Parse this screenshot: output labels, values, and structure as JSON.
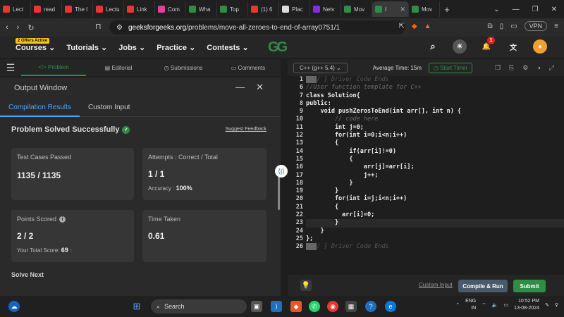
{
  "browser": {
    "tabs": [
      {
        "label": "Lect",
        "color": "#e33"
      },
      {
        "label": "read",
        "color": "#e33"
      },
      {
        "label": "The I",
        "color": "#e33"
      },
      {
        "label": "Lectu",
        "color": "#e33"
      },
      {
        "label": "Link",
        "color": "#e33"
      },
      {
        "label": "Com",
        "color": "#e040a0"
      },
      {
        "label": "Wha",
        "color": "#2f8d46"
      },
      {
        "label": "Top",
        "color": "#2f8d46"
      },
      {
        "label": "(1) 6",
        "color": "#e33"
      },
      {
        "label": "Plac",
        "color": "#ddd"
      },
      {
        "label": "Netv",
        "color": "#8a2be2"
      },
      {
        "label": "Mov",
        "color": "#2f8d46"
      },
      {
        "label": "I",
        "color": "#2f8d46"
      },
      {
        "label": "Mov",
        "color": "#2f8d46"
      }
    ],
    "active_tab_index": 12,
    "url_domain": "geeksforgeeks.org",
    "url_path": "/problems/move-all-zeroes-to-end-of-array0751/1",
    "vpn_label": "VPN"
  },
  "site": {
    "offer_badge": "2 Offers Active",
    "nav": [
      "Courses",
      "Tutorials",
      "Jobs",
      "Practice",
      "Contests"
    ],
    "logo": "GG",
    "notification_count": "1"
  },
  "left_tabs": [
    "Problem",
    "Editorial",
    "Submissions",
    "Comments"
  ],
  "output": {
    "title": "Output Window",
    "tabs": [
      "Compilation Results",
      "Custom Input"
    ],
    "status": "Problem Solved Successfully",
    "feedback_link": "Suggest Feedback",
    "test_cases_label": "Test Cases Passed",
    "test_cases_value": "1135 / 1135",
    "attempts_label": "Attempts : Correct / Total",
    "attempts_value": "1 / 1",
    "accuracy_label": "Accuracy :",
    "accuracy_value": "100%",
    "points_label": "Points Scored",
    "points_value": "2 / 2",
    "total_score_label": "Your Total Score:",
    "total_score_value": "69",
    "time_label": "Time Taken",
    "time_value": "0.61",
    "solve_next": "Solve Next"
  },
  "editor": {
    "language": "C++ (g++ 5.4)",
    "average_time": "Average Time: 15m",
    "start_timer": "Start Timer",
    "line_numbers": [
      "1",
      "6",
      "7",
      "8",
      "9",
      "10",
      "11",
      "12",
      "13",
      "14",
      "15",
      "16",
      "17",
      "18",
      "19",
      "20",
      "21",
      "22",
      "23",
      "24",
      "25",
      "26"
    ],
    "lines": [
      "/ } Driver Code Ends",
      "//User function template for C++",
      "class Solution{",
      "public:",
      "    void pushZerosToEnd(int arr[], int n) {",
      "        // code here",
      "        int j=0;",
      "        for(int i=0;i<n;i++)",
      "        {",
      "            if(arr[i]!=0)",
      "            {",
      "                arr[j]=arr[i];",
      "                j++;",
      "            }",
      "        }",
      "        for(int i=j;i<n;i++)",
      "        {",
      "          arr[i]=0;",
      "        }",
      "    }",
      "};",
      "/ } Driver Code Ends"
    ],
    "custom_input": "Custom Input",
    "compile_run": "Compile & Run",
    "submit": "Submit"
  },
  "taskbar": {
    "search_placeholder": "Search",
    "language_line1": "ENG",
    "language_line2": "IN",
    "time": "10:52 PM",
    "date": "13-08-2024"
  }
}
